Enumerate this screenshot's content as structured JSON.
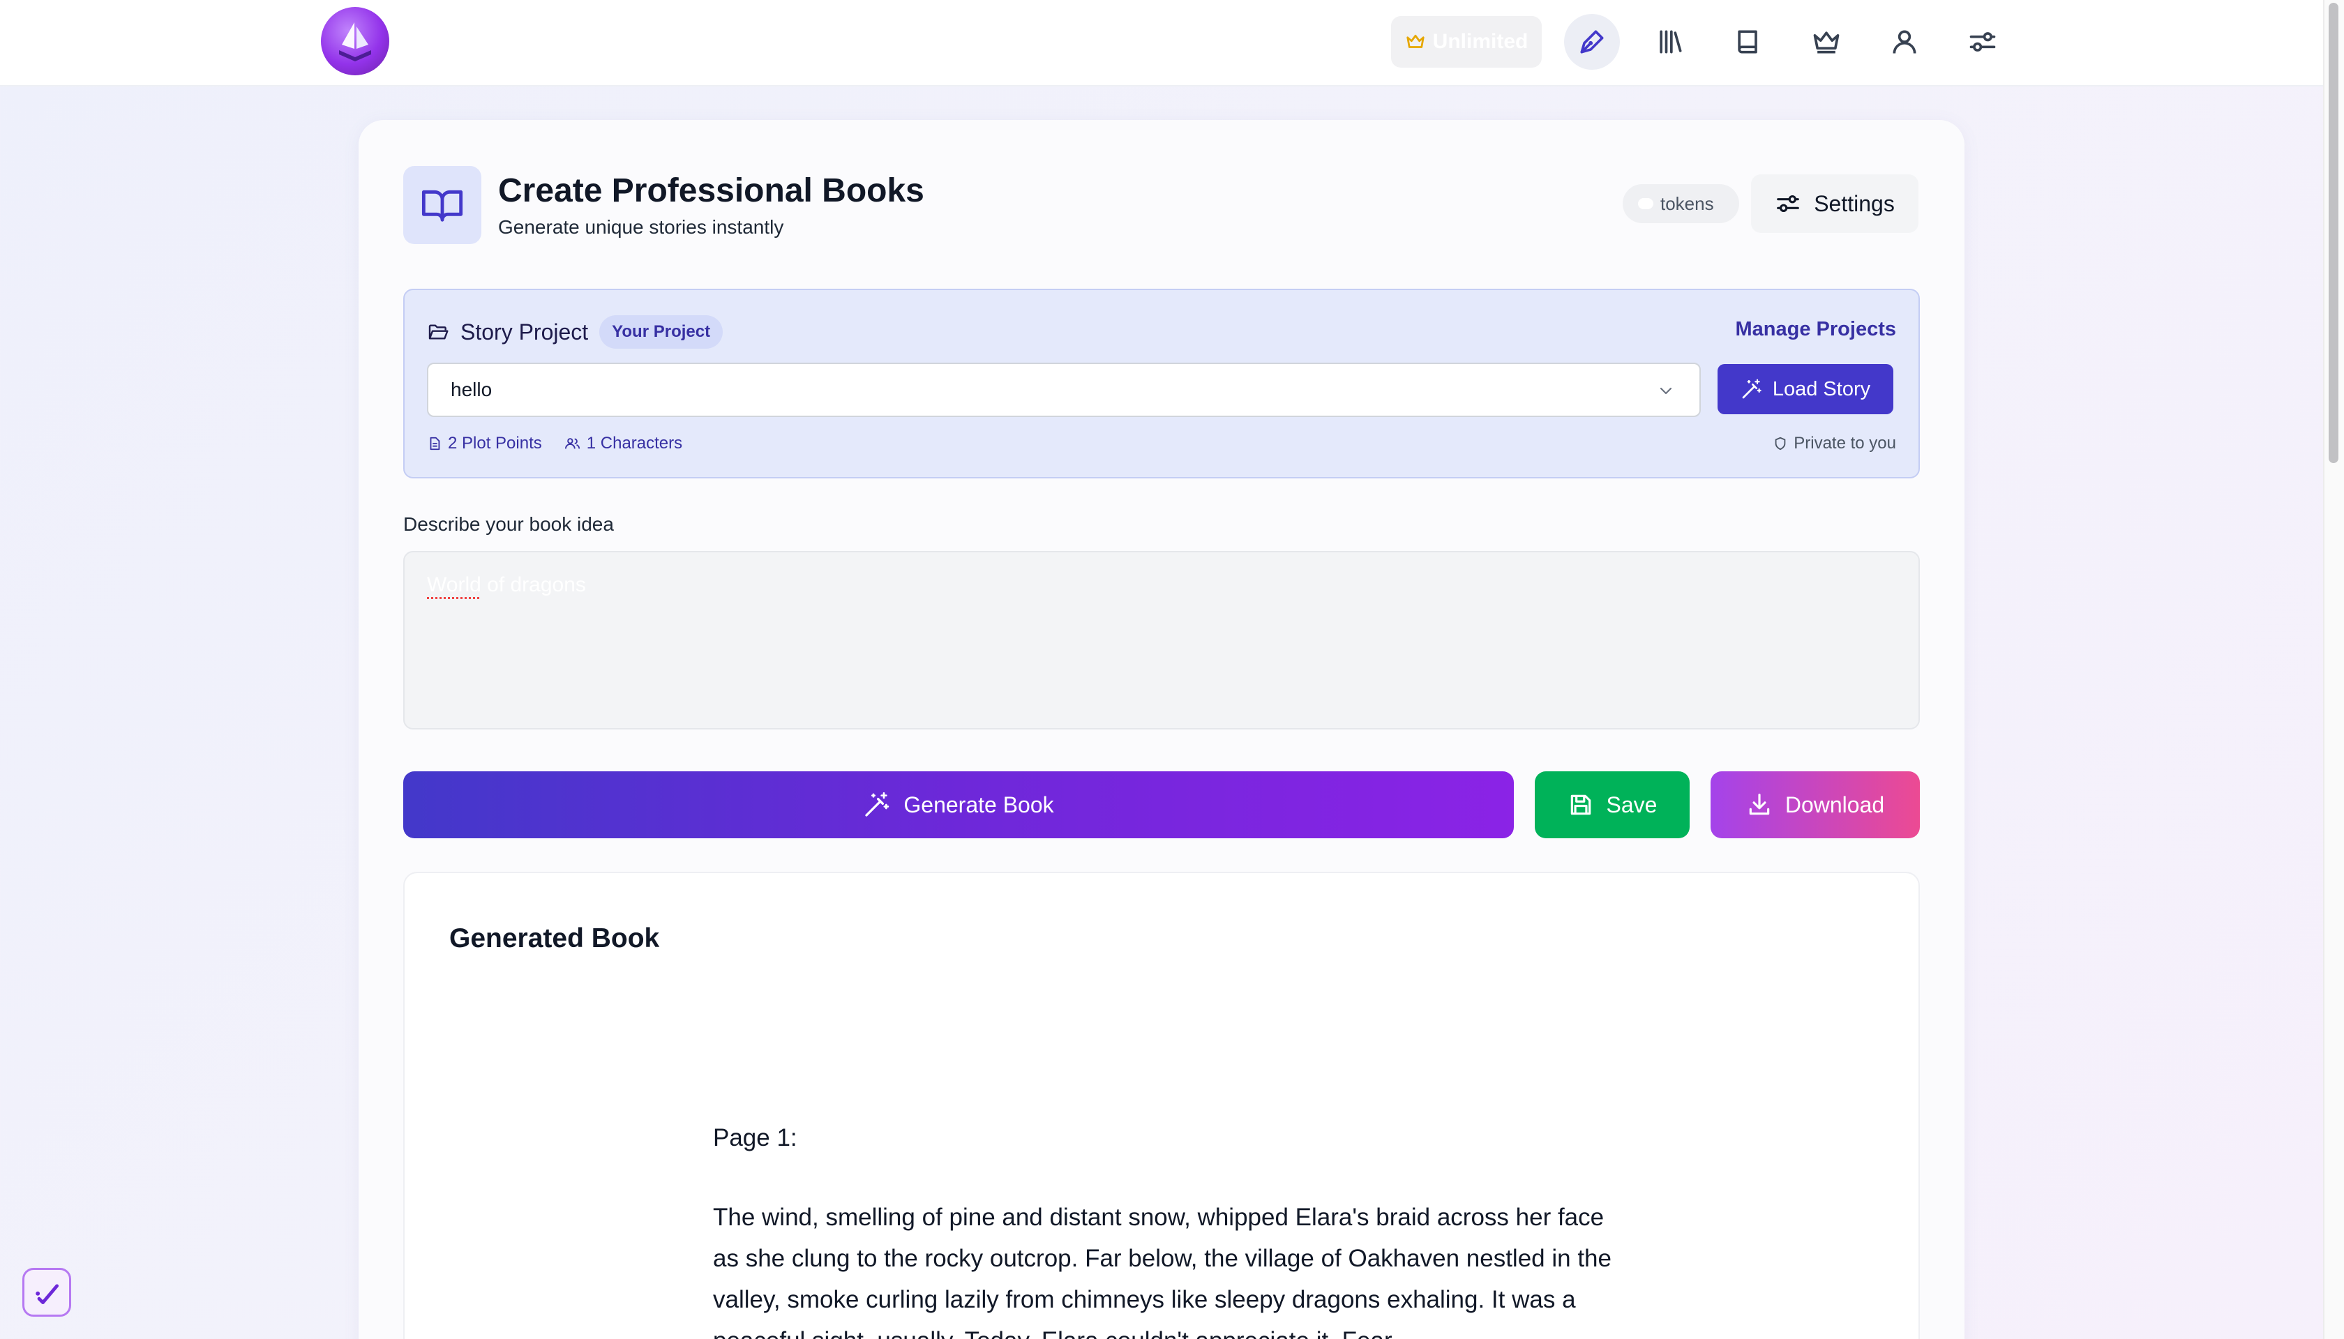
{
  "nav": {
    "unlimited_label": "Unlimited",
    "icons": [
      "pen-icon",
      "library-icon",
      "book-icon",
      "crown-icon",
      "user-icon",
      "sliders-icon"
    ]
  },
  "header": {
    "title": "Create Professional Books",
    "subtitle": "Generate unique stories instantly",
    "tokens_label": "tokens",
    "settings_label": "Settings"
  },
  "project": {
    "title": "Story Project",
    "badge": "Your Project",
    "manage_label": "Manage Projects",
    "selected": "hello",
    "load_label": "Load Story",
    "plot_points": "2 Plot Points",
    "characters": "1 Characters",
    "privacy": "Private to you"
  },
  "idea": {
    "label": "Describe your book idea",
    "word1": "World",
    "word2": " of dragons"
  },
  "actions": {
    "generate_label": "Generate Book",
    "save_label": "Save",
    "download_label": "Download"
  },
  "book": {
    "heading": "Generated Book",
    "page_label": "Page 1:",
    "text": "The wind, smelling of pine and distant snow, whipped Elara's braid across her face as she clung to the rocky outcrop. Far below, the village of Oakhaven nestled in the valley, smoke curling lazily from chimneys like sleepy dragons exhaling. It was a peaceful sight, usually. Today, Elara couldn't appreciate it. Fear"
  },
  "colors": {
    "primary": "#4338ca",
    "save": "#00b259",
    "accent_pink": "#ec4a93",
    "accent_purple": "#8b23e6"
  }
}
